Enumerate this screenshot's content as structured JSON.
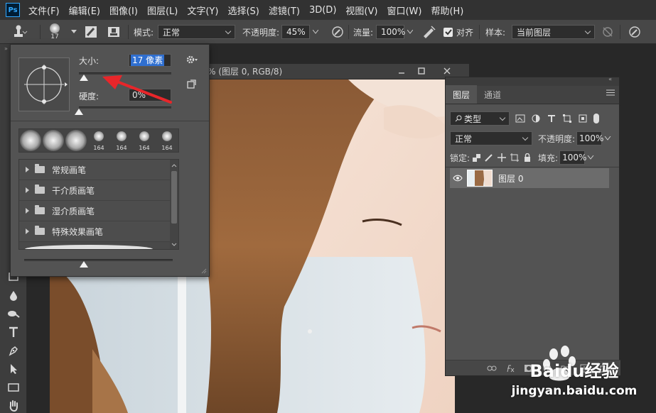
{
  "app": {
    "logo": "Ps"
  },
  "menu": [
    "文件(F)",
    "编辑(E)",
    "图像(I)",
    "图层(L)",
    "文字(Y)",
    "选择(S)",
    "滤镜(T)",
    "3D(D)",
    "视图(V)",
    "窗口(W)",
    "帮助(H)"
  ],
  "options": {
    "brush_size_badge": "17",
    "mode_label": "模式:",
    "mode_value": "正常",
    "opacity_label": "不透明度:",
    "opacity_value": "45%",
    "flow_label": "流量:",
    "flow_value": "100%",
    "align_label": "对齐",
    "align_checked": true,
    "sample_label": "样本:",
    "sample_value": "当前图层"
  },
  "document": {
    "title": "% (图层 0, RGB/8)"
  },
  "brush_panel": {
    "size_label": "大小:",
    "size_value": "17 像素",
    "size_slider_fraction": 0.05,
    "hardness_label": "硬度:",
    "hardness_value": "0%",
    "hardness_slider_fraction": 0.0,
    "tips": [
      {
        "label": ""
      },
      {
        "label": ""
      },
      {
        "label": ""
      },
      {
        "label": "164"
      },
      {
        "label": "164"
      },
      {
        "label": "164"
      },
      {
        "label": "164"
      }
    ],
    "folders": [
      "常规画笔",
      "干介质画笔",
      "湿介质画笔",
      "特殊效果画笔"
    ],
    "bottom_slider_fraction": 0.4
  },
  "layers_panel": {
    "tabs": [
      "图层",
      "通道"
    ],
    "filter_kind": "类型",
    "blend_mode": "正常",
    "opacity_label": "不透明度:",
    "opacity_value": "100%",
    "lock_label": "锁定:",
    "fill_label": "填充:",
    "fill_value": "100%",
    "layers": [
      {
        "name": "图层 0",
        "visible": true
      }
    ]
  },
  "watermark": {
    "brand": "Baidu经验",
    "url": "jingyan.baidu.com"
  },
  "colors": {
    "annotation_arrow": "#e8262a",
    "selection": "#2f6fd0",
    "accent_blue": "#31a8ff"
  }
}
